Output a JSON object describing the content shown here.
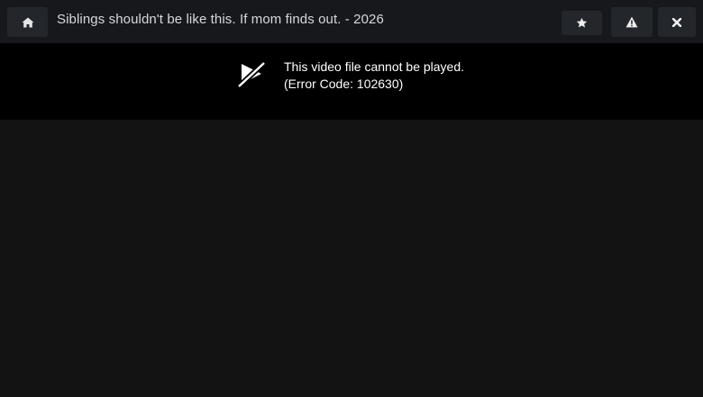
{
  "header": {
    "title": "Siblings shouldn't be like this. If mom finds out. - 2026",
    "buttons": {
      "home_icon": "home-icon",
      "favorite_icon": "star-icon",
      "report_icon": "warning-icon",
      "close_icon": "close-icon"
    }
  },
  "player": {
    "error_message": "This video file cannot be played.",
    "error_code": "(Error Code: 102630)",
    "error_icon": "video-slash-icon"
  },
  "colors": {
    "topbar_bg": "#16181c",
    "button_bg": "#23262b",
    "player_bg": "#000000",
    "page_bg": "#131313",
    "title_text": "#d6d8db"
  }
}
